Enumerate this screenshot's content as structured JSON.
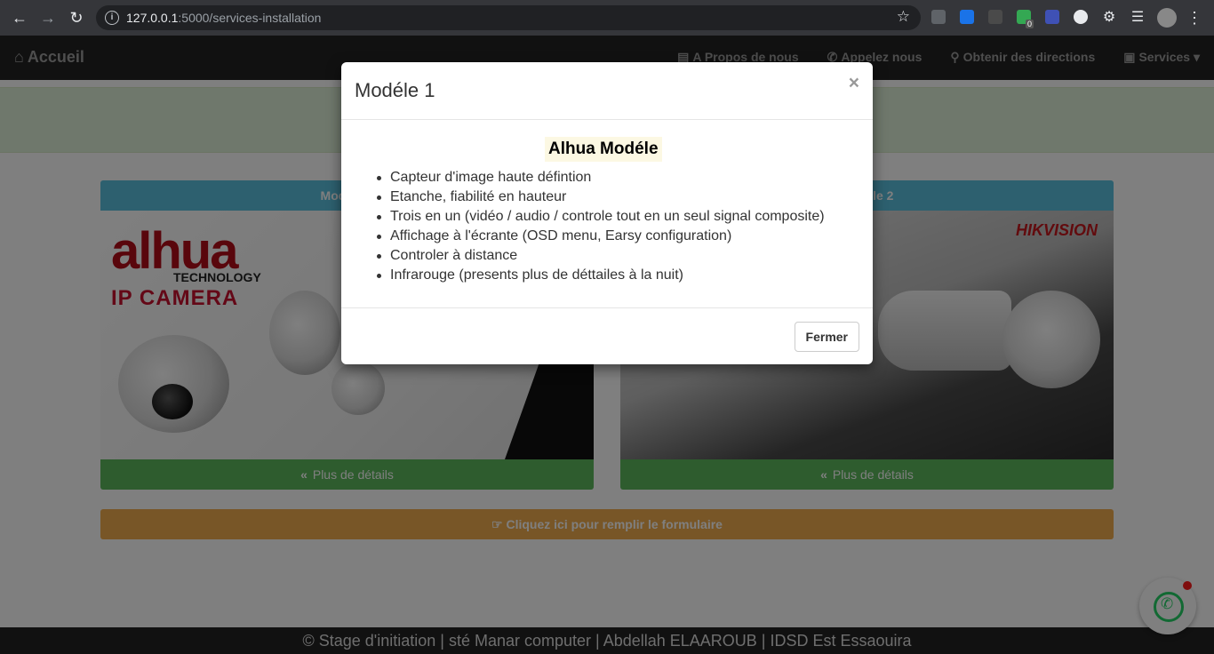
{
  "browser": {
    "url_host": "127.0.0.1",
    "url_path": ":5000/services-installation",
    "extension_badge": "0"
  },
  "navbar": {
    "brand": "Accueil",
    "links": [
      "A Propos de nous",
      "Appelez nous",
      "Obtenir des directions",
      "Services"
    ]
  },
  "cards": [
    {
      "header": "Modèle 1",
      "image_logo": "alhua",
      "image_tagline": "TECHNOLOGY",
      "image_product": "IP CAMERA",
      "details_label": "Plus de détails"
    },
    {
      "header": "Modèle 2",
      "image_logo": "HIKVISION",
      "details_label": "Plus de détails"
    }
  ],
  "form_button": "Cliquez ici pour remplir le formulaire",
  "footer": "© Stage d'initiation | sté Manar computer | Abdellah ELAAROUB | IDSD Est Essaouira",
  "modal": {
    "title": "Modéle 1",
    "close": "×",
    "heading": "Alhua Modéle",
    "features": [
      "Capteur d'image haute défintion",
      "Etanche, fiabilité en hauteur",
      "Trois en un (vidéo / audio / controle tout en un seul signal composite)",
      "Affichage à l'écrante (OSD menu, Earsy configuration)",
      "Controler à distance",
      "Infrarouge (presents plus de déttailes à la nuit)"
    ],
    "close_button": "Fermer"
  },
  "colors": {
    "navbar": "#222222",
    "info_header": "#5bc0de",
    "success": "#5cb85c",
    "warning": "#f0ad4e",
    "whatsapp": "#25d366"
  }
}
